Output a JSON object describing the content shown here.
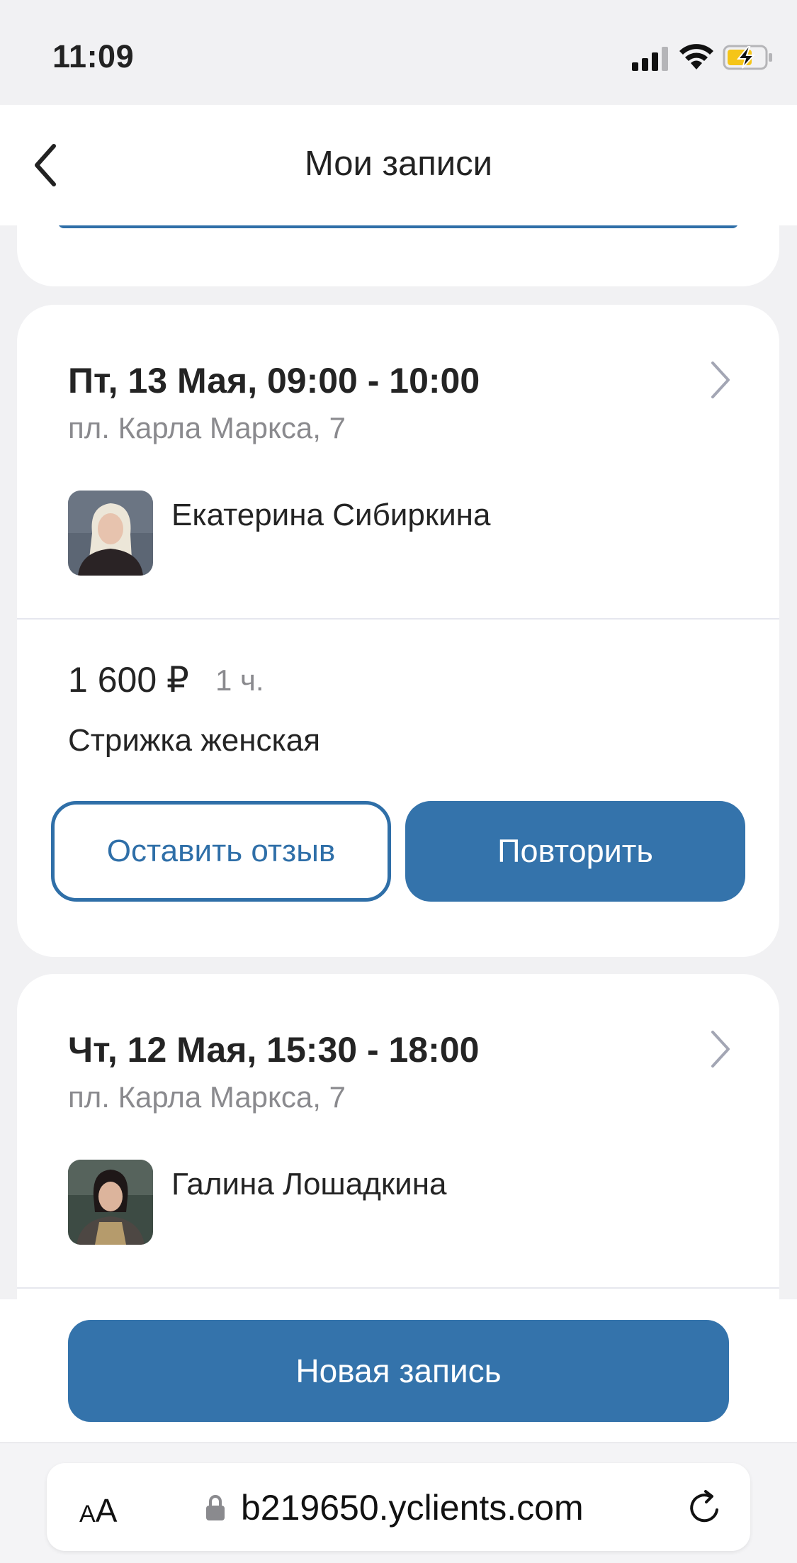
{
  "status_bar": {
    "time": "11:09"
  },
  "header": {
    "title": "Мои записи"
  },
  "appointments": [
    {
      "datetime": "Пт, 13 Мая, 09:00 - 10:00",
      "address": "пл. Карла Маркса, 7",
      "master": "Екатерина Сибиркина",
      "price": "1 600 ₽",
      "duration": "1 ч.",
      "service": "Стрижка женская",
      "review_label": "Оставить отзыв",
      "repeat_label": "Повторить"
    },
    {
      "datetime": "Чт, 12 Мая, 15:30 - 18:00",
      "address": "пл. Карла Маркса, 7",
      "master": "Галина Лошадкина"
    }
  ],
  "actions": {
    "new_booking_label": "Новая запись"
  },
  "browser": {
    "text_size_label_small": "A",
    "text_size_label_large": "A",
    "url": "b219650.yclients.com"
  },
  "colors": {
    "accent": "#3473ab",
    "background": "#f1f1f3",
    "muted_text": "#8a8a8e"
  },
  "icons": [
    "back-chevron-icon",
    "chevron-right-icon",
    "cellular-signal-icon",
    "wifi-icon",
    "battery-charging-icon",
    "lock-icon",
    "reload-icon"
  ]
}
